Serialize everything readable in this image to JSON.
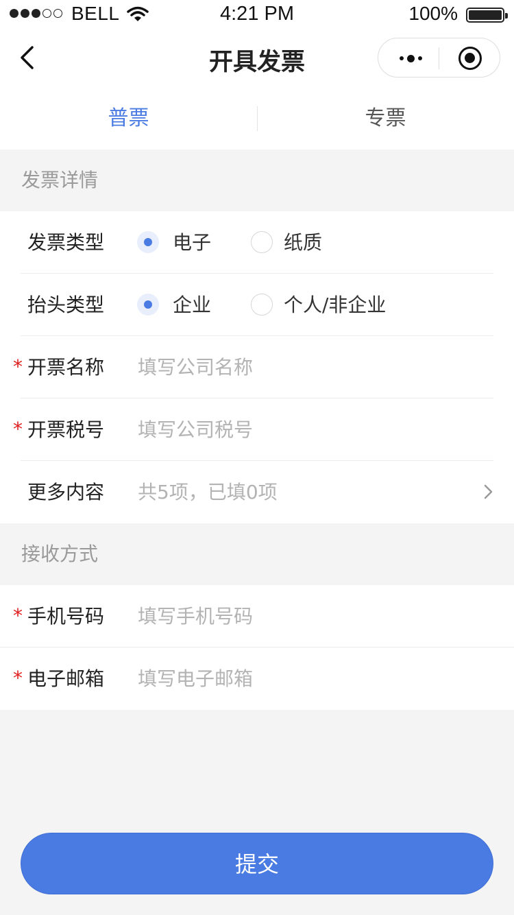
{
  "status_bar": {
    "carrier": "BELL",
    "time": "4:21 PM",
    "battery": "100%"
  },
  "nav": {
    "title": "开具发票"
  },
  "tabs": [
    {
      "label": "普票",
      "active": true
    },
    {
      "label": "专票",
      "active": false
    }
  ],
  "invoice_section": {
    "header": "发票详情",
    "invoice_type": {
      "label": "发票类型",
      "options": [
        "电子",
        "纸质"
      ],
      "selected": "电子"
    },
    "title_type": {
      "label": "抬头类型",
      "options": [
        "企业",
        "个人/非企业"
      ],
      "selected": "企业"
    },
    "invoice_name": {
      "label": "开票名称",
      "placeholder": "填写公司名称",
      "required": true
    },
    "tax_number": {
      "label": "开票税号",
      "placeholder": "填写公司税号",
      "required": true
    },
    "more": {
      "label": "更多内容",
      "value": "共5项，已填0项"
    }
  },
  "receive_section": {
    "header": "接收方式",
    "phone": {
      "label": "手机号码",
      "placeholder": "填写手机号码",
      "required": true
    },
    "email": {
      "label": "电子邮箱",
      "placeholder": "填写电子邮箱",
      "required": true
    }
  },
  "required_mark": "*",
  "submit_label": "提交",
  "colors": {
    "accent": "#4a7be3",
    "required": "#e02020",
    "placeholder": "#b3b3b3",
    "background": "#f4f4f4"
  }
}
